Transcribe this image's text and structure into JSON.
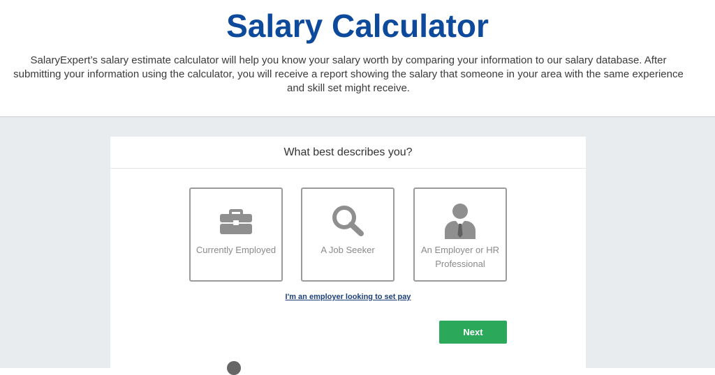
{
  "header": {
    "title": "Salary Calculator",
    "intro": "SalaryExpert’s salary estimate calculator will help you know your salary worth by comparing your information to our salary database. After submitting your information using the calculator, you will receive a report showing the salary that someone in your area with the same experience and skill set might receive."
  },
  "card": {
    "question": "What best describes you?",
    "options": [
      {
        "label": "Currently Employed",
        "icon": "briefcase-icon"
      },
      {
        "label": "A Job Seeker",
        "icon": "search-icon"
      },
      {
        "label": "An Employer or HR Professional",
        "icon": "person-tie-icon"
      }
    ],
    "employer_link": "I'm an employer looking to set pay",
    "next_label": "Next"
  },
  "colors": {
    "title": "#0d4a9c",
    "next_button": "#2ba85a",
    "icon_gray": "#8f8f8f",
    "background": "#e9ecef"
  }
}
